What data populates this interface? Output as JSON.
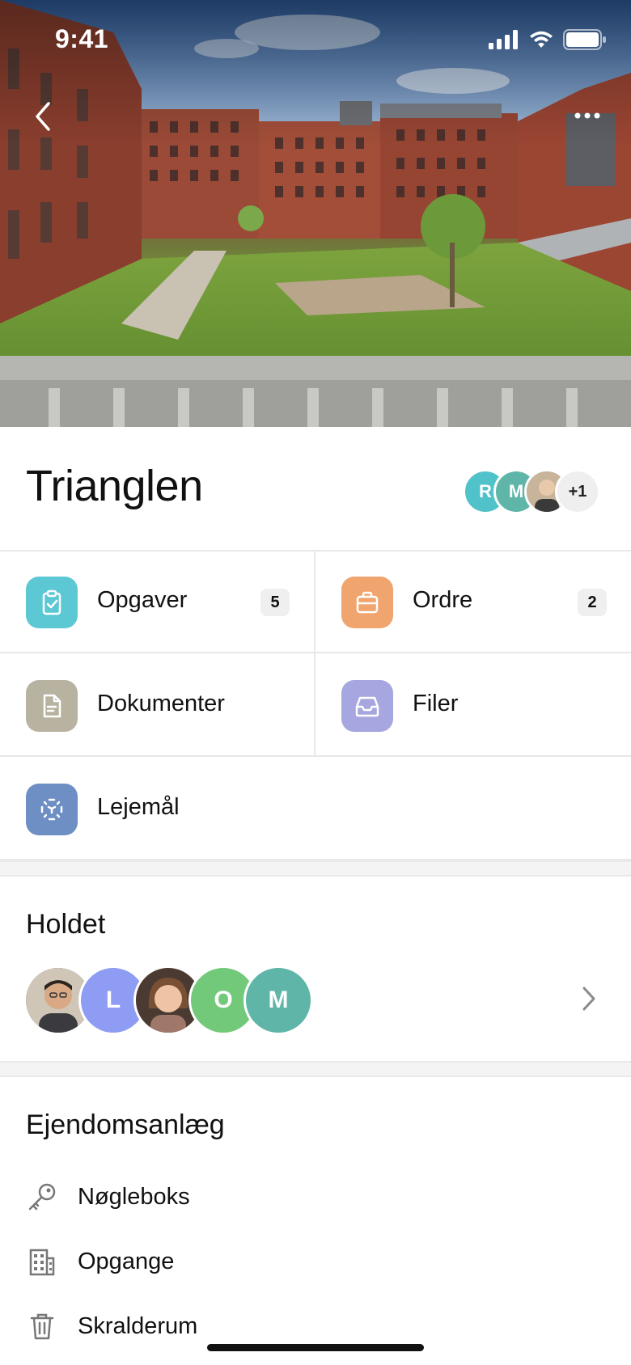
{
  "status_bar": {
    "time": "9:41"
  },
  "hero": {
    "image_alt": "Courtyard of brick apartment buildings"
  },
  "property": {
    "title": "Trianglen",
    "members": [
      {
        "initial": "R",
        "color": "#4fc3c9"
      },
      {
        "initial": "M",
        "color": "#5fb5a8"
      },
      {
        "initial": "",
        "color": "#b9a58f"
      }
    ],
    "extra_members": "+1"
  },
  "grid": {
    "items": [
      {
        "label": "Opgaver",
        "badge": "5",
        "color": "#5cc8d4",
        "icon": "clipboard-check-icon"
      },
      {
        "label": "Ordre",
        "badge": "2",
        "color": "#f0a46e",
        "icon": "briefcase-icon"
      },
      {
        "label": "Dokumenter",
        "badge": "",
        "color": "#b8b3a0",
        "icon": "document-icon"
      },
      {
        "label": "Filer",
        "badge": "",
        "color": "#a6a6e0",
        "icon": "inbox-icon"
      },
      {
        "label": "Lejemål",
        "badge": "",
        "color": "#6d8fc4",
        "icon": "focus-scan-icon"
      }
    ]
  },
  "team": {
    "title": "Holdet",
    "avatars": [
      {
        "initial": "",
        "color": "#7a6a5a"
      },
      {
        "initial": "L",
        "color": "#8e9cf3"
      },
      {
        "initial": "",
        "color": "#b88a6a"
      },
      {
        "initial": "O",
        "color": "#73c97a"
      },
      {
        "initial": "M",
        "color": "#5fb5a8"
      }
    ]
  },
  "facilities": {
    "title": "Ejendomsanlæg",
    "items": [
      {
        "label": "Nøgleboks",
        "icon": "key-icon"
      },
      {
        "label": "Opgange",
        "icon": "building-icon"
      },
      {
        "label": "Skralderum",
        "icon": "trash-icon"
      }
    ]
  }
}
